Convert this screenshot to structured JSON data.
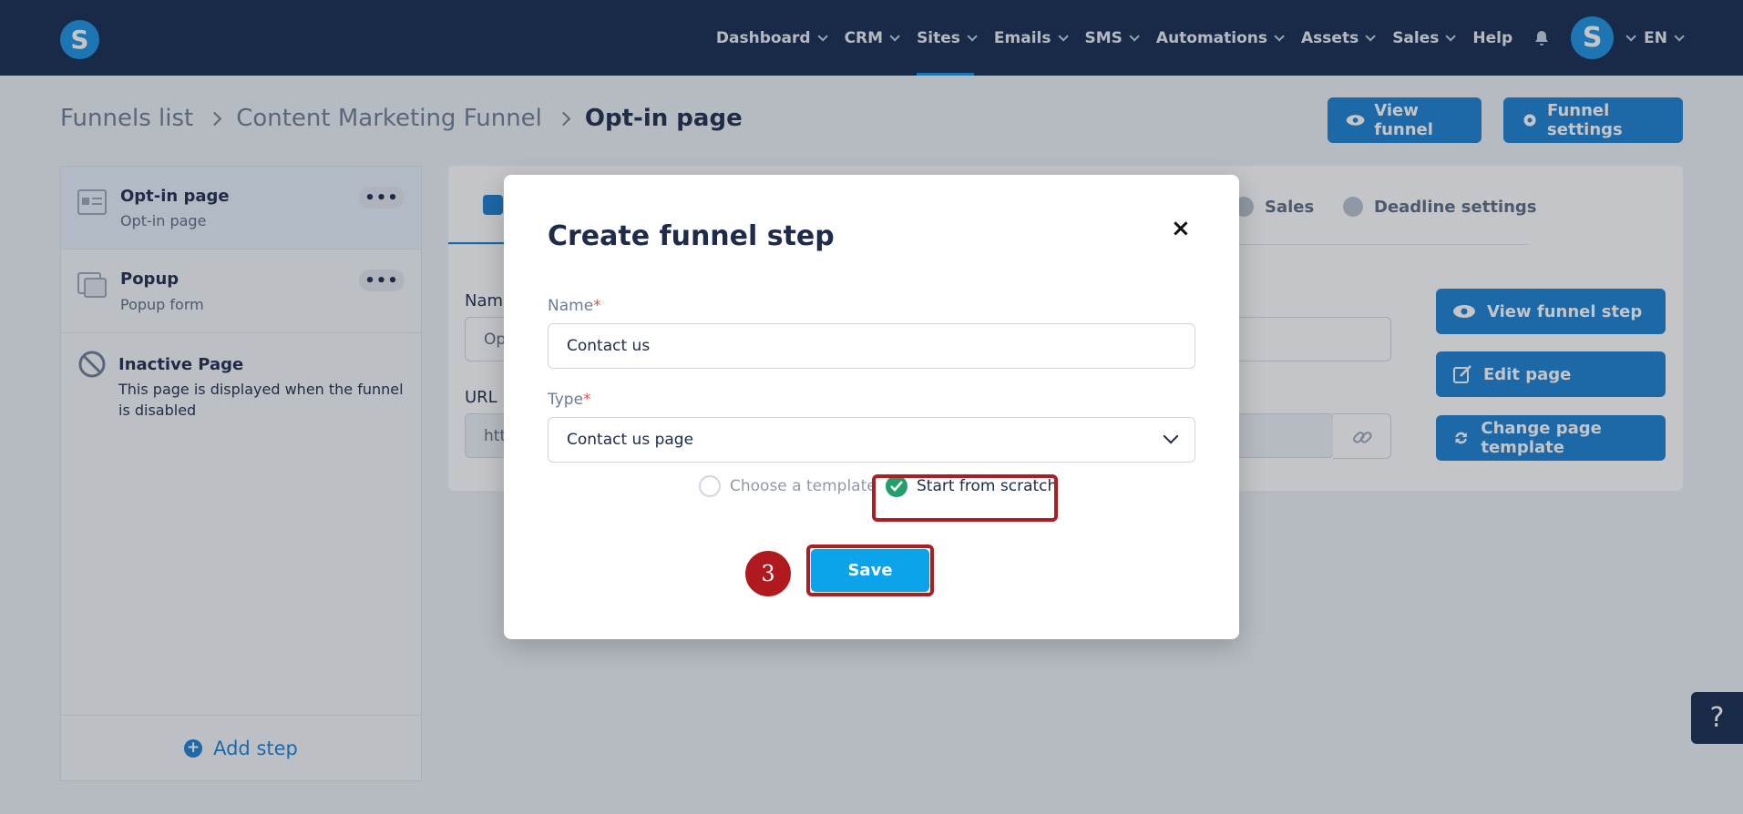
{
  "nav": {
    "logo": "S",
    "items": [
      {
        "label": "Dashboard",
        "has_caret": true
      },
      {
        "label": "CRM",
        "has_caret": true
      },
      {
        "label": "Sites",
        "has_caret": true,
        "active": true
      },
      {
        "label": "Emails",
        "has_caret": true
      },
      {
        "label": "SMS",
        "has_caret": true
      },
      {
        "label": "Automations",
        "has_caret": true
      },
      {
        "label": "Assets",
        "has_caret": true
      },
      {
        "label": "Sales",
        "has_caret": true
      },
      {
        "label": "Help",
        "has_caret": false
      }
    ],
    "avatar": "S",
    "language": "EN"
  },
  "breadcrumb": {
    "item1": "Funnels list",
    "item2": "Content Marketing Funnel",
    "current": "Opt-in page"
  },
  "header": {
    "view_funnel": "View funnel",
    "funnel_settings": "Funnel settings"
  },
  "steps": [
    {
      "title": "Opt-in page",
      "subtitle": "Opt-in page",
      "menu": "•••"
    },
    {
      "title": "Popup",
      "subtitle": "Popup form",
      "menu": "•••"
    },
    {
      "title": "Inactive Page",
      "subtitle": "This page is displayed when the funnel is disabled"
    }
  ],
  "add_step": "Add step",
  "main": {
    "tabs": [
      "Sales",
      "Deadline settings"
    ],
    "name_label": "Nam",
    "name_value": "Op",
    "url_label": "URL I",
    "url_value": "htt",
    "buttons": {
      "view_step": "View funnel step",
      "edit_page": "Edit page",
      "change_template": "Change page template"
    }
  },
  "help_button": "?",
  "modal": {
    "title": "Create funnel step",
    "close": "×",
    "name_label": "Name",
    "name_value": "Contact us",
    "type_label": "Type",
    "type_value": "Contact us page",
    "required_mark": "*",
    "option_template": "Choose a template",
    "option_scratch": "Start from scratch",
    "save": "Save",
    "step_badge": "3"
  },
  "colors": {
    "nav_bg": "#14294f",
    "primary": "#1a7fd0",
    "save_button": "#0ba3ea",
    "highlight": "#a81f26",
    "check": "#22a06b"
  }
}
